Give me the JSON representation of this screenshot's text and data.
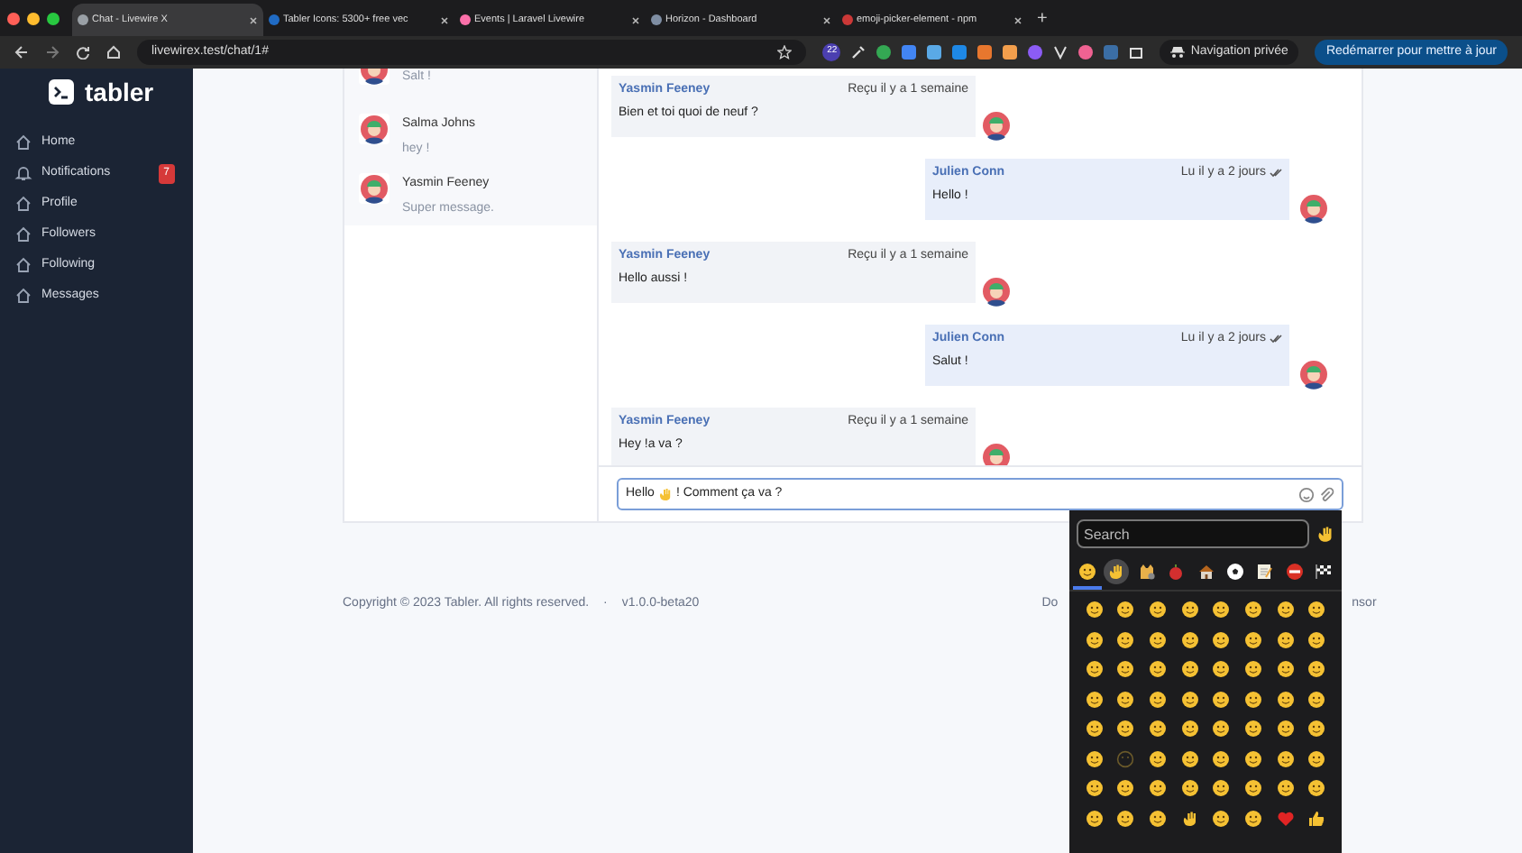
{
  "browser": {
    "tabs": [
      {
        "title": "Chat - Livewire X",
        "selected": true,
        "color": "#9aa0a6"
      },
      {
        "title": "Tabler Icons: 5300+ free vec",
        "selected": false,
        "color": "#206bc4"
      },
      {
        "title": "Events | Laravel Livewire",
        "selected": false,
        "color": "#fb70a9"
      },
      {
        "title": "Horizon - Dashboard",
        "selected": false,
        "color": "#7f8ea3"
      },
      {
        "title": "emoji-picker-element - npm",
        "selected": false,
        "color": "#cb3837"
      }
    ],
    "new_tab": "+",
    "url": "livewirex.test/chat/1#",
    "extension_badge": "22",
    "profile": "Navigation privée",
    "update_button": "Redémarrer pour mettre à jour"
  },
  "sidebar": {
    "logo": "tabler",
    "items": [
      {
        "label": "Home",
        "kind": "home"
      },
      {
        "label": "Notifications",
        "kind": "bell",
        "badge": "7"
      },
      {
        "label": "Profile",
        "kind": "home"
      },
      {
        "label": "Followers",
        "kind": "home"
      },
      {
        "label": "Following",
        "kind": "home"
      },
      {
        "label": "Messages",
        "kind": "home"
      }
    ]
  },
  "conversations": [
    {
      "preview": "Salt !"
    },
    {
      "name": "Salma Johns",
      "preview": "hey !"
    },
    {
      "name": "Yasmin Feeney",
      "preview": "Super message."
    }
  ],
  "messages": [
    {
      "kind": "received",
      "author": "Yasmin Feeney",
      "status": "Reçu il y a 1 semaine",
      "read": false,
      "text": "Bien et toi quoi de neuf ?"
    },
    {
      "kind": "sent",
      "author": "Julien Conn",
      "status": "Lu il y a 2 jours",
      "read": true,
      "text": "Hello !"
    },
    {
      "kind": "received",
      "author": "Yasmin Feeney",
      "status": "Reçu il y a 1 semaine",
      "read": false,
      "text": "Hello aussi !"
    },
    {
      "kind": "sent",
      "author": "Julien Conn",
      "status": "Lu il y a 2 jours",
      "read": true,
      "text": "Salut !"
    },
    {
      "kind": "received",
      "author": "Yasmin Feeney",
      "status": "Reçu il y a 1 semaine",
      "read": false,
      "text": "Hey !a va ?"
    }
  ],
  "composer": {
    "text_before": "Hello",
    "text_after": "! Comment ça va ?"
  },
  "footer": {
    "copyright": "Copyright © 2023 Tabler. All rights reserved.",
    "separator": "·",
    "version": "v1.0.0-beta20",
    "link_left": "Do",
    "link_right": "nsor"
  },
  "emoji_picker": {
    "placeholder": "Search",
    "categories": [
      {
        "kind": "smileys",
        "selected": true,
        "hovered": false
      },
      {
        "kind": "people",
        "selected": false,
        "hovered": true
      },
      {
        "kind": "animals",
        "selected": false,
        "hovered": false
      },
      {
        "kind": "food",
        "selected": false,
        "hovered": false
      },
      {
        "kind": "travel",
        "selected": false,
        "hovered": false
      },
      {
        "kind": "activities",
        "selected": false,
        "hovered": false
      },
      {
        "kind": "objects",
        "selected": false,
        "hovered": false
      },
      {
        "kind": "symbols",
        "selected": false,
        "hovered": false
      },
      {
        "kind": "flags",
        "selected": false,
        "hovered": false
      }
    ]
  }
}
